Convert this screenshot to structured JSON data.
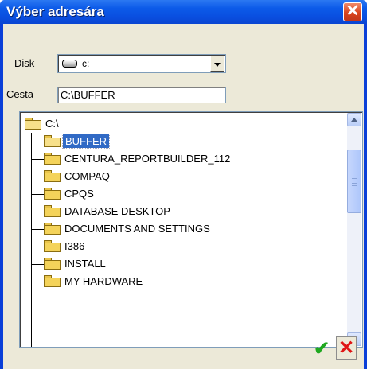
{
  "window": {
    "title": "Výber adresára",
    "close_symbol": "✕"
  },
  "drive": {
    "label_underline": "D",
    "label_rest": "isk",
    "value": "c:",
    "icon": "drive-icon"
  },
  "path": {
    "label_underline": "C",
    "label_rest": "esta",
    "value": "C:\\BUFFER"
  },
  "tree": {
    "root": "C:\\",
    "selected": "BUFFER",
    "children": [
      "BUFFER",
      "CENTURA_REPORTBUILDER_112",
      "COMPAQ",
      "CPQS",
      "DATABASE DESKTOP",
      "DOCUMENTS AND SETTINGS",
      "I386",
      "INSTALL",
      "MY HARDWARE"
    ]
  },
  "buttons": {
    "ok_symbol": "✔",
    "cancel_symbol": "✕"
  },
  "colors": {
    "titlebar": "#0a4fe0",
    "selection": "#316ac5",
    "client": "#ece9d8",
    "ok": "#1fa81f",
    "cancel": "#e01515"
  }
}
